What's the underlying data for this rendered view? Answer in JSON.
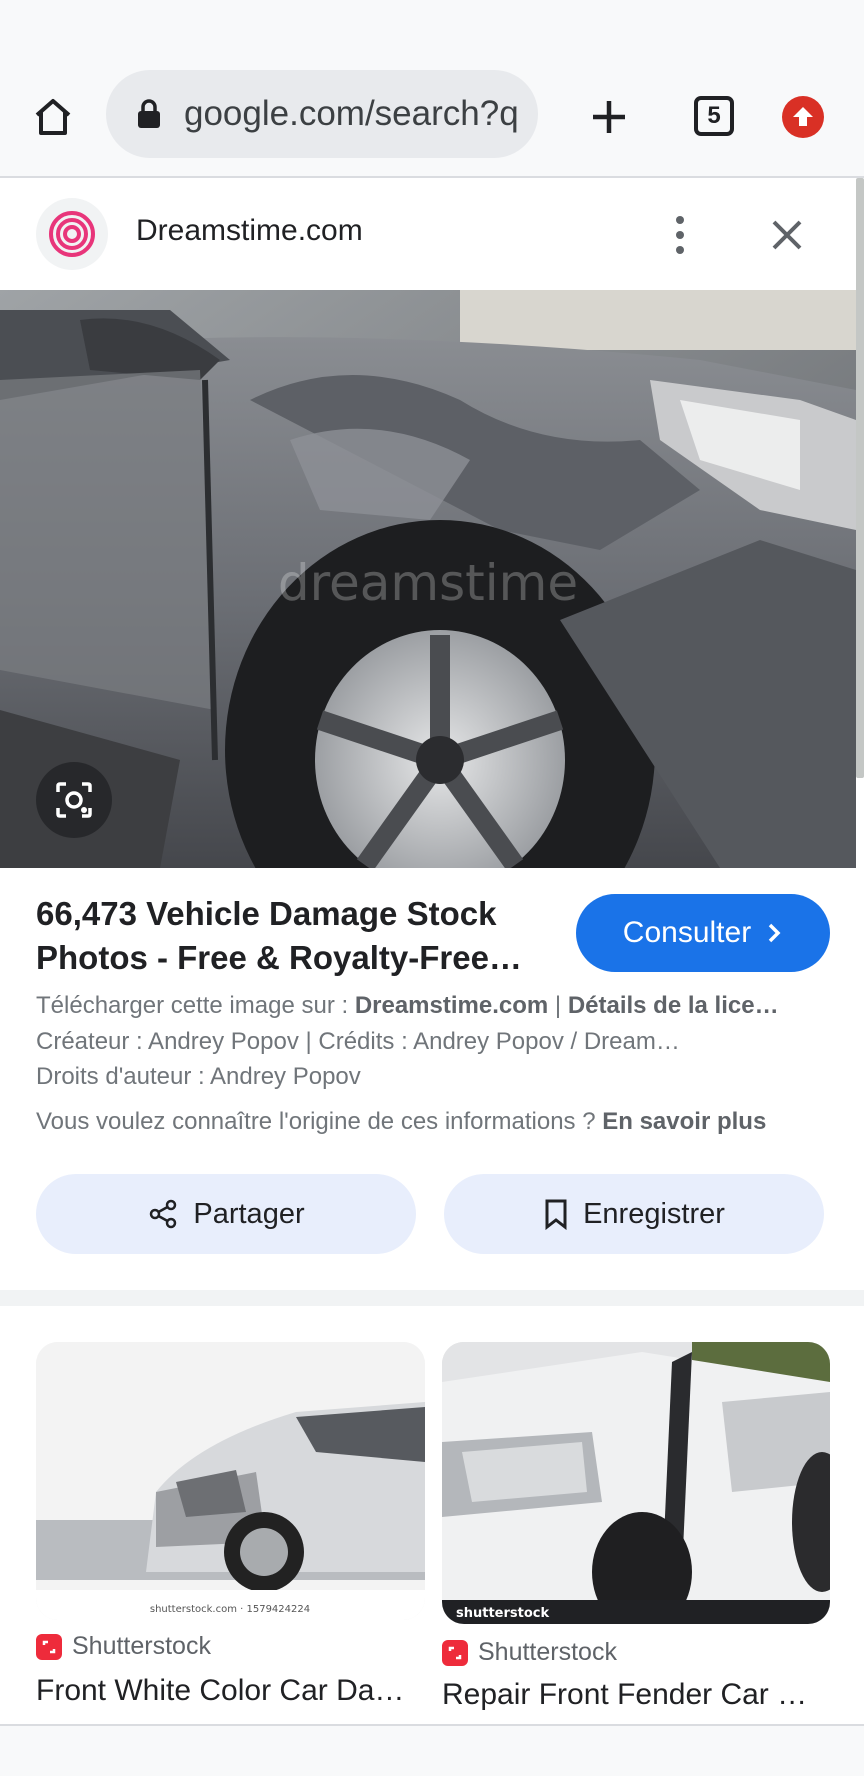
{
  "browser": {
    "url": "google.com/search?q",
    "tab_count": "5",
    "icons": [
      "home-icon",
      "lock-icon",
      "plus-icon",
      "tab-switcher-icon",
      "update-icon"
    ],
    "update_color": "#d93025"
  },
  "panel": {
    "site_name": "Dreamstime.com",
    "watermark": "dreamstime"
  },
  "result": {
    "title": "66,473 Vehicle Damage Stock Photos - Free & Royalty-Free…",
    "consult_label": "Consulter",
    "accent": "#1a73e8",
    "download_prefix": "Télécharger cette image sur : ",
    "download_site": "Dreamstime.com",
    "download_sep": " | ",
    "license_label": "Détails de la lice…",
    "creator_line": "Créateur : Andrey Popov | Crédits : Andrey Popov / Dream…",
    "copyright_line": "Droits d'auteur : Andrey Popov",
    "origin_question": "Vous voulez connaître l'origine de ces informations ? ",
    "learn_more": "En savoir plus"
  },
  "actions": {
    "share_label": "Partager",
    "save_label": "Enregistrer"
  },
  "related": [
    {
      "source": "Shutterstock",
      "title": "Front White Color Car Da…",
      "watermark": "shutterstock.com · 1579424224"
    },
    {
      "source": "Shutterstock",
      "title": "Repair Front Fender Car …",
      "watermark": "shutterstock"
    }
  ]
}
